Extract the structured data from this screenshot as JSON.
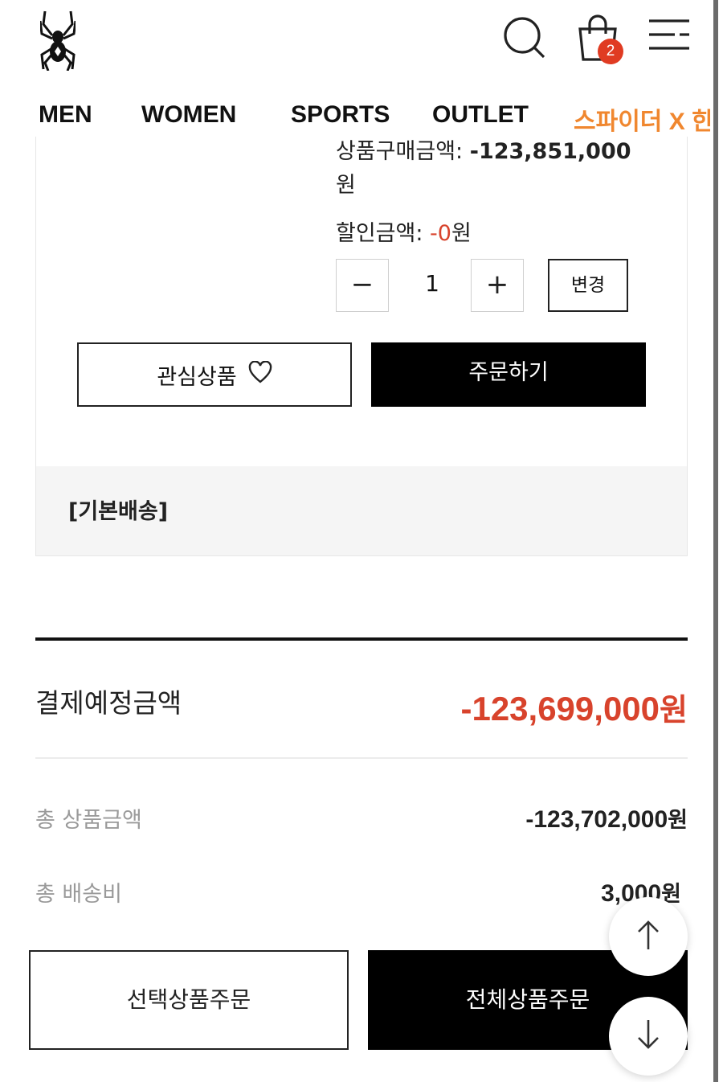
{
  "header": {
    "logo_icon": "spider-logo-icon",
    "search_icon": "search-icon",
    "bag_icon": "shopping-bag-icon",
    "cart_count": "2",
    "menu_icon": "menu-icon"
  },
  "nav": {
    "items": [
      "MEN",
      "WOMEN",
      "SPORTS",
      "OUTLET",
      "스파이더 X 한"
    ],
    "accent_color": "#f0872f"
  },
  "product": {
    "purchase_amount_label": "상품구매금액: ",
    "purchase_amount_value": "-123,851,000",
    "purchase_amount_unit": "원",
    "discount_label": "할인금액: ",
    "discount_value": "-0",
    "discount_unit": "원",
    "quantity": "1",
    "minus_symbol": "−",
    "plus_symbol": "+",
    "change_label": "변경",
    "wishlist_label": "관심상품",
    "wishlist_icon": "heart-icon",
    "order_label": "주문하기",
    "shipping_label": "[기본배송]"
  },
  "summary": {
    "payment_label": "결제예정금액",
    "payment_value": "-123,699,000",
    "payment_unit": "원",
    "total_products_label": "총 상품금액",
    "total_products_value": "-123,702,000",
    "total_products_unit": "원",
    "total_shipping_label": "총 배송비",
    "total_shipping_value": "3,000",
    "total_shipping_unit": "원",
    "accent_color": "#d8432c"
  },
  "actions": {
    "order_selected_label": "선택상품주문",
    "order_all_label": "전체상품주문",
    "scroll_up_icon": "arrow-up-icon",
    "scroll_down_icon": "arrow-down-icon"
  }
}
